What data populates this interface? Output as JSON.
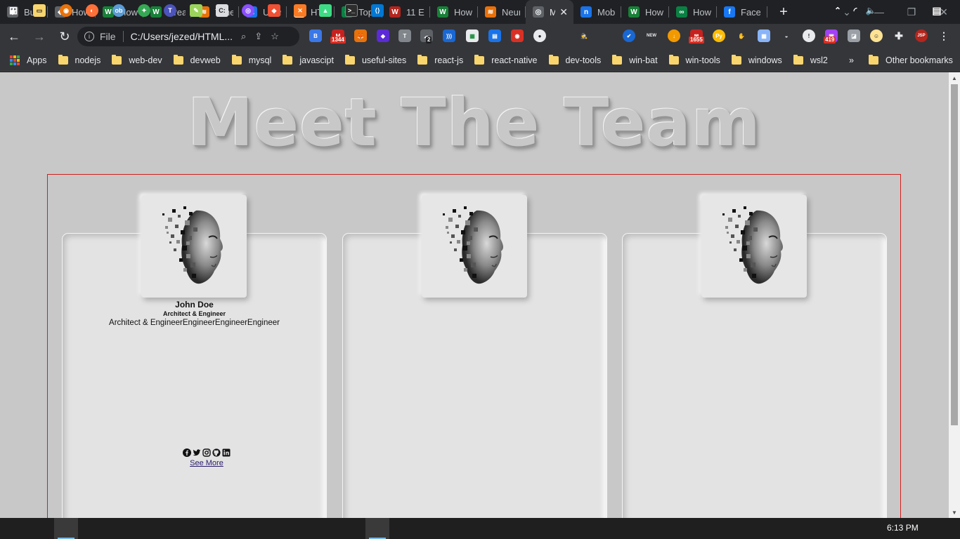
{
  "browser": {
    "tabs": [
      {
        "title": "Build",
        "color": "#5f6368",
        "glyph": "◆"
      },
      {
        "title": "How",
        "color": "#5f6368",
        "glyph": "◆"
      },
      {
        "title": "How",
        "color": "#188038",
        "glyph": "W"
      },
      {
        "title": "Creat",
        "color": "#188038",
        "glyph": "W"
      },
      {
        "title": "Time",
        "color": "#e8710a",
        "glyph": "≋"
      },
      {
        "title": "User",
        "color": "#1a73e8",
        "glyph": "ℍ"
      },
      {
        "title": "HTM",
        "color": "#ffffff",
        "glyph": "▭"
      },
      {
        "title": "Top 1",
        "color": "#0b8043",
        "glyph": "∞"
      },
      {
        "title": "11 Ex",
        "color": "#b3261e",
        "glyph": "W"
      },
      {
        "title": "How",
        "color": "#188038",
        "glyph": "W"
      },
      {
        "title": "Neur",
        "color": "#e8710a",
        "glyph": "≋"
      },
      {
        "title": "M",
        "color": "#5f6368",
        "glyph": "◎",
        "active": true
      },
      {
        "title": "Mob",
        "color": "#1a73e8",
        "glyph": "n"
      },
      {
        "title": "How",
        "color": "#188038",
        "glyph": "W"
      },
      {
        "title": "How",
        "color": "#0b8043",
        "glyph": "∞"
      },
      {
        "title": "Facel",
        "color": "#1877f2",
        "glyph": "f"
      }
    ],
    "new_tab_label": "+",
    "address": {
      "scheme_label": "File",
      "url": "C:/Users/jezed/HTML..."
    },
    "badges": {
      "gmail": "1344",
      "ext_count": "2",
      "ext_1655": "1655",
      "ext_419": "419",
      "new_label": "NEW",
      "jsp_label": "JSP"
    },
    "bookmarks": [
      "Apps",
      "nodejs",
      "web-dev",
      "devweb",
      "mysql",
      "javascipt",
      "useful-sites",
      "react-js",
      "react-native",
      "dev-tools",
      "win-bat",
      "win-tools",
      "windows",
      "wsl2"
    ],
    "more_bookmarks": "»",
    "other_bookmarks": "Other bookmarks"
  },
  "page": {
    "heading": "Meet The Team",
    "members": [
      {
        "name": "John Doe",
        "role": "Architect & Engineer",
        "description": "Architect & EngineerEngineerEngineerEngineer",
        "link": "See More"
      }
    ]
  },
  "taskbar": {
    "time": "6:13 PM"
  },
  "colors": {
    "page_bg": "#c8c8c8",
    "card_bg": "#e3e3e3",
    "container_border": "#d21f1f",
    "link": "#2a1b6b"
  }
}
